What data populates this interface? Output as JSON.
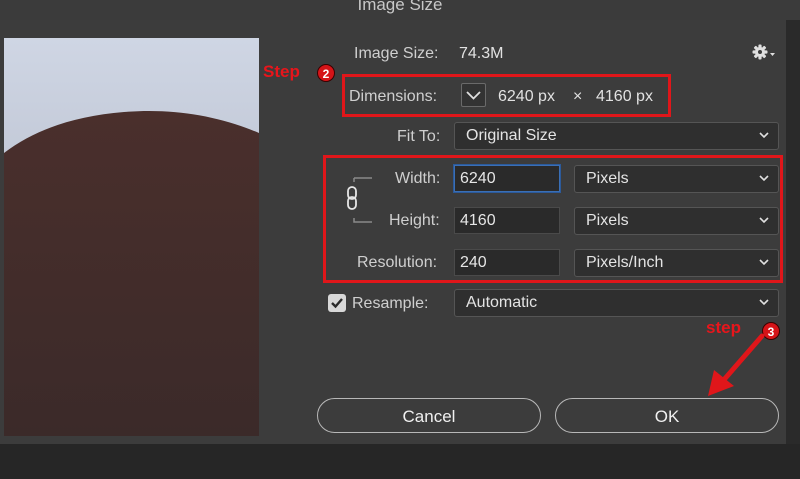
{
  "window": {
    "title": "Image Size"
  },
  "info": {
    "image_size_label": "Image Size:",
    "image_size_value": "74.3M",
    "gear_icon": "gear-icon"
  },
  "dimensions": {
    "label": "Dimensions:",
    "width": "6240 px",
    "times": "×",
    "height": "4160 px"
  },
  "fit_to": {
    "label": "Fit To:",
    "value": "Original Size"
  },
  "width": {
    "label": "Width:",
    "value": "6240",
    "unit": "Pixels"
  },
  "height": {
    "label": "Height:",
    "value": "4160",
    "unit": "Pixels"
  },
  "resolution": {
    "label": "Resolution:",
    "value": "240",
    "unit": "Pixels/Inch"
  },
  "resample": {
    "label": "Resample:",
    "checked": true,
    "value": "Automatic"
  },
  "buttons": {
    "cancel": "Cancel",
    "ok": "OK"
  },
  "annotations": {
    "step2_label": "Step",
    "step2_number": "2",
    "step3_label": "step",
    "step3_number": "3",
    "color": "#e0161a"
  }
}
